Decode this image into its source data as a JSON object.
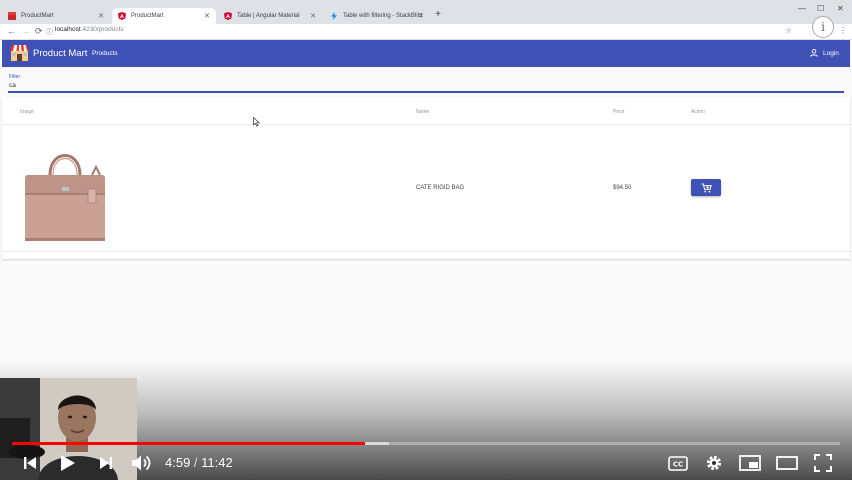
{
  "browser": {
    "tabs": [
      {
        "title": "ProductMart",
        "active": false,
        "icon": "product-mart-favicon"
      },
      {
        "title": "ProductMart",
        "active": true,
        "icon": "angular-favicon"
      },
      {
        "title": "Table | Angular Material",
        "active": false,
        "icon": "angular-favicon"
      },
      {
        "title": "Table with filtering - StackBlitz",
        "active": false,
        "icon": "stackblitz-favicon"
      }
    ],
    "url_host": "localhost",
    "url_rest": ":4230/products",
    "info_icon": "i"
  },
  "app": {
    "title": "Product Mart",
    "nav_products": "Products",
    "login_label": "Login",
    "primary_color": "#3f51b5"
  },
  "filter": {
    "label": "Filter",
    "value": "ca"
  },
  "table": {
    "headers": {
      "image": "Image",
      "name": "Name",
      "price": "Price",
      "action": "Action"
    },
    "rows": [
      {
        "name": "CATE RIGID BAG",
        "price": "$94.50",
        "image_icon": "handbag-image",
        "action_icon": "add-shopping-cart-icon"
      }
    ]
  },
  "video": {
    "current_time": "4:59",
    "separator": " / ",
    "duration": "11:42",
    "played_fraction": 0.426,
    "buffered_fraction": 0.455,
    "progress_color": "#ff0000"
  }
}
